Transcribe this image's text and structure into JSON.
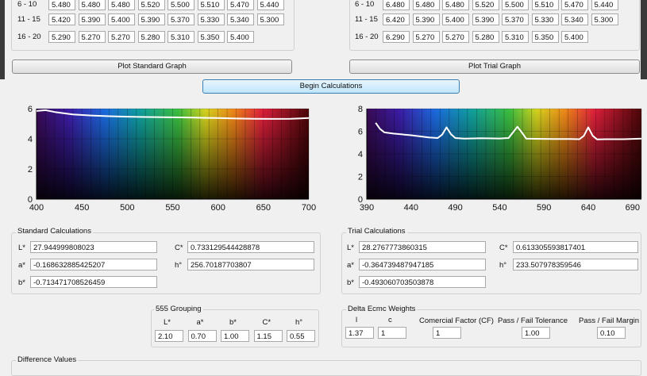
{
  "standard_table": {
    "rows": [
      {
        "label": "6 - 10",
        "values": [
          "5.480",
          "5.480",
          "5.480",
          "5.520",
          "5.500",
          "5.510",
          "5.470",
          "5.440"
        ]
      },
      {
        "label": "11 - 15",
        "values": [
          "5.420",
          "5.390",
          "5.400",
          "5.390",
          "5.370",
          "5.330",
          "5.340",
          "5.300"
        ]
      },
      {
        "label": "16 - 20",
        "values": [
          "5.290",
          "5.270",
          "5.270",
          "5.280",
          "5.310",
          "5.350",
          "5.400"
        ]
      }
    ]
  },
  "trial_table": {
    "rows": [
      {
        "label": "6 - 10",
        "values": [
          "6.480",
          "5.480",
          "5.480",
          "5.520",
          "5.500",
          "5.510",
          "5.470",
          "5.440"
        ]
      },
      {
        "label": "11 - 15",
        "values": [
          "6.420",
          "5.390",
          "5.400",
          "5.390",
          "5.370",
          "5.330",
          "5.340",
          "5.300"
        ]
      },
      {
        "label": "16 - 20",
        "values": [
          "6.290",
          "5.270",
          "5.270",
          "5.280",
          "5.310",
          "5.350",
          "5.400"
        ]
      }
    ]
  },
  "buttons": {
    "plot_standard": "Plot Standard Graph",
    "plot_trial": "Plot Trial Graph",
    "begin_calculations": "Begin Calculations"
  },
  "chart_data": [
    {
      "type": "line",
      "title": "",
      "xlabel": "",
      "ylabel": "",
      "xlim": [
        400,
        700
      ],
      "ylim": [
        0,
        6
      ],
      "xticks": [
        400,
        450,
        500,
        550,
        600,
        650,
        700
      ],
      "yticks": [
        0,
        2,
        4,
        6
      ],
      "background": "visible-spectrum",
      "grid": true,
      "series": [
        {
          "color": "#ffffff",
          "x": [
            400,
            410,
            420,
            440,
            460,
            480,
            500,
            520,
            540,
            560,
            580,
            600,
            620,
            640,
            660,
            680,
            700
          ],
          "y": [
            5.85,
            5.9,
            5.78,
            5.62,
            5.55,
            5.5,
            5.47,
            5.45,
            5.43,
            5.42,
            5.4,
            5.38,
            5.35,
            5.33,
            5.32,
            5.33,
            5.38
          ]
        }
      ]
    },
    {
      "type": "line",
      "title": "",
      "xlabel": "",
      "ylabel": "",
      "xlim": [
        390,
        700
      ],
      "ylim": [
        0,
        8
      ],
      "xticks": [
        390,
        440,
        490,
        540,
        590,
        640,
        690
      ],
      "yticks": [
        0,
        2,
        4,
        6,
        8
      ],
      "background": "visible-spectrum",
      "grid": true,
      "series": [
        {
          "color": "#ffffff",
          "x": [
            400,
            405,
            410,
            420,
            440,
            460,
            470,
            475,
            480,
            485,
            490,
            500,
            520,
            540,
            550,
            555,
            560,
            565,
            570,
            580,
            600,
            620,
            630,
            635,
            640,
            645,
            650,
            660,
            680,
            700
          ],
          "y": [
            6.75,
            6.2,
            5.9,
            5.8,
            5.65,
            5.45,
            5.4,
            5.7,
            6.35,
            5.75,
            5.4,
            5.35,
            5.38,
            5.36,
            5.4,
            5.9,
            6.4,
            5.9,
            5.35,
            5.33,
            5.32,
            5.32,
            5.3,
            5.6,
            6.35,
            5.6,
            5.28,
            5.3,
            5.3,
            5.35
          ]
        }
      ]
    }
  ],
  "standard_calc": {
    "title": "Standard Calculations",
    "L_label": "L*",
    "L": "27.944999808023",
    "a_label": "a*",
    "a": "-0.168632885425207",
    "b_label": "b*",
    "b": "-0.713471708526459",
    "C_label": "C*",
    "C": "0.733129544428878",
    "h_label": "h°",
    "h": "256.70187703807"
  },
  "trial_calc": {
    "title": "Trial Calculations",
    "L_label": "L*",
    "L": "28.2767773860315",
    "a_label": "a*",
    "a": "-0.364739487947185",
    "b_label": "b*",
    "b": "-0.493060703503878",
    "C_label": "C*",
    "C": "0.613305593817401",
    "h_label": "h°",
    "h": "233.507978359546"
  },
  "grouping_555": {
    "title": "555 Grouping",
    "headers": [
      "L*",
      "a*",
      "b*",
      "C*",
      "h°"
    ],
    "values": [
      "2.10",
      "0.70",
      "1.00",
      "1.15",
      "0.55"
    ]
  },
  "delta_ecmc": {
    "title": "Delta Ecmc Weights",
    "l_label": "l",
    "l_value": "1.37",
    "c_label": "c",
    "c_value": "1",
    "cf_label": "Comercial Factor (CF)",
    "cf_value": "1",
    "tol_label": "Pass / Fail Tolerance",
    "tol_value": "1.00",
    "margin_label": "Pass / Fail Margin",
    "margin_value": "0.10"
  },
  "difference": {
    "title": "Difference Values"
  }
}
